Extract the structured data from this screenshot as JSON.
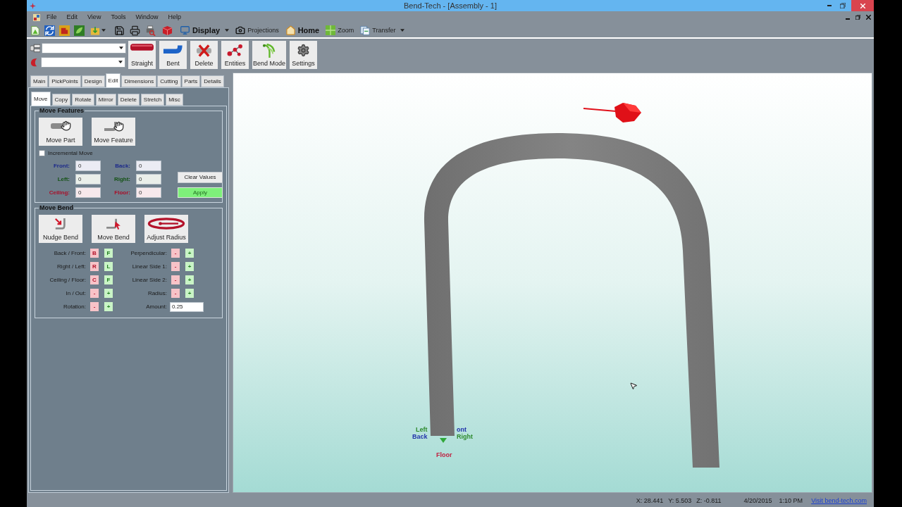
{
  "window": {
    "title": "Bend-Tech - [Assembly - 1]"
  },
  "menu": [
    "File",
    "Edit",
    "View",
    "Tools",
    "Window",
    "Help"
  ],
  "toolbar": [
    {
      "label": "Display",
      "bold": true,
      "dropdown": true
    },
    {
      "label": "Projections",
      "bold": false,
      "dropdown": false
    },
    {
      "label": "Home",
      "bold": true,
      "dropdown": false
    },
    {
      "label": "Zoom",
      "bold": false,
      "dropdown": false
    },
    {
      "label": "Transfer",
      "bold": false,
      "dropdown": true
    }
  ],
  "ribbon": {
    "buttons": [
      "Straight",
      "Bent",
      "Delete",
      "Entities",
      "Bend Mode",
      "Settings"
    ]
  },
  "tabs": [
    {
      "label": "Main",
      "selected": false
    },
    {
      "label": "PickPoints",
      "selected": false
    },
    {
      "label": "Design",
      "selected": false
    },
    {
      "label": "Edit",
      "selected": true
    },
    {
      "label": "Dimensions",
      "selected": false
    },
    {
      "label": "Cutting",
      "selected": false
    },
    {
      "label": "Parts",
      "selected": false
    },
    {
      "label": "Details",
      "selected": false
    }
  ],
  "subtabs": [
    {
      "label": "Move",
      "selected": true
    },
    {
      "label": "Copy",
      "selected": false
    },
    {
      "label": "Rotate",
      "selected": false
    },
    {
      "label": "Mirror",
      "selected": false
    },
    {
      "label": "Delete",
      "selected": false
    },
    {
      "label": "Stretch",
      "selected": false
    },
    {
      "label": "Misc",
      "selected": false
    }
  ],
  "move_features": {
    "title": "Move Features",
    "buttons": [
      "Move Part",
      "Move Feature"
    ],
    "incremental_move": {
      "label": "Incremental Move",
      "checked": false
    },
    "fields": [
      {
        "label": "Front:",
        "value": "0",
        "color": "#1c2a8a"
      },
      {
        "label": "Back:",
        "value": "0",
        "color": "#1c2a8a"
      },
      {
        "label": "Left:",
        "value": "0",
        "color": "#145214"
      },
      {
        "label": "Right:",
        "value": "0",
        "color": "#145214"
      },
      {
        "label": "Ceiling:",
        "value": "0",
        "color": "#a8102a"
      },
      {
        "label": "Floor:",
        "value": "0",
        "color": "#a8102a"
      }
    ],
    "clear_button": "Clear Values",
    "apply_button": "Apply"
  },
  "move_bend": {
    "title": "Move Bend",
    "buttons": [
      "Nudge Bend",
      "Move Bend",
      "Adjust Radius"
    ],
    "left_rows": [
      {
        "label": "Back / Front:",
        "buttons": [
          "B",
          "F"
        ]
      },
      {
        "label": "Right / Left:",
        "buttons": [
          "R",
          "L"
        ]
      },
      {
        "label": "Ceiling / Floor:",
        "buttons": [
          "C",
          "F"
        ]
      },
      {
        "label": "In / Out:",
        "buttons": [
          "-",
          "+"
        ]
      },
      {
        "label": "Rotation:",
        "buttons": [
          "-",
          "+"
        ]
      }
    ],
    "right_rows": [
      {
        "label": "Perpendicular:",
        "buttons": [
          "-",
          "+"
        ]
      },
      {
        "label": "Linear Side 1:",
        "buttons": [
          "-",
          "+"
        ]
      },
      {
        "label": "Linear Side 2:",
        "buttons": [
          "-",
          "+"
        ]
      },
      {
        "label": "Radius:",
        "buttons": [
          "-",
          "+"
        ]
      }
    ],
    "amount": {
      "label": "Amount:",
      "value": "0.25"
    }
  },
  "viewport": {
    "axis_labels": [
      {
        "text": "Left",
        "color": "#2e8a2e"
      },
      {
        "text": "Back",
        "color": "#2233aa"
      },
      {
        "text": "ont",
        "color": "#2233aa"
      },
      {
        "text": "Right",
        "color": "#2e8a2e"
      },
      {
        "text": "Floor",
        "color": "#c02040"
      }
    ]
  },
  "status_bar": {
    "coordinates": [
      "X: 28.441",
      "Y: 5.503",
      "Z: -0.811"
    ],
    "date": "4/20/2015",
    "time": "1:10 PM",
    "link": "Visit bend-tech.com"
  }
}
